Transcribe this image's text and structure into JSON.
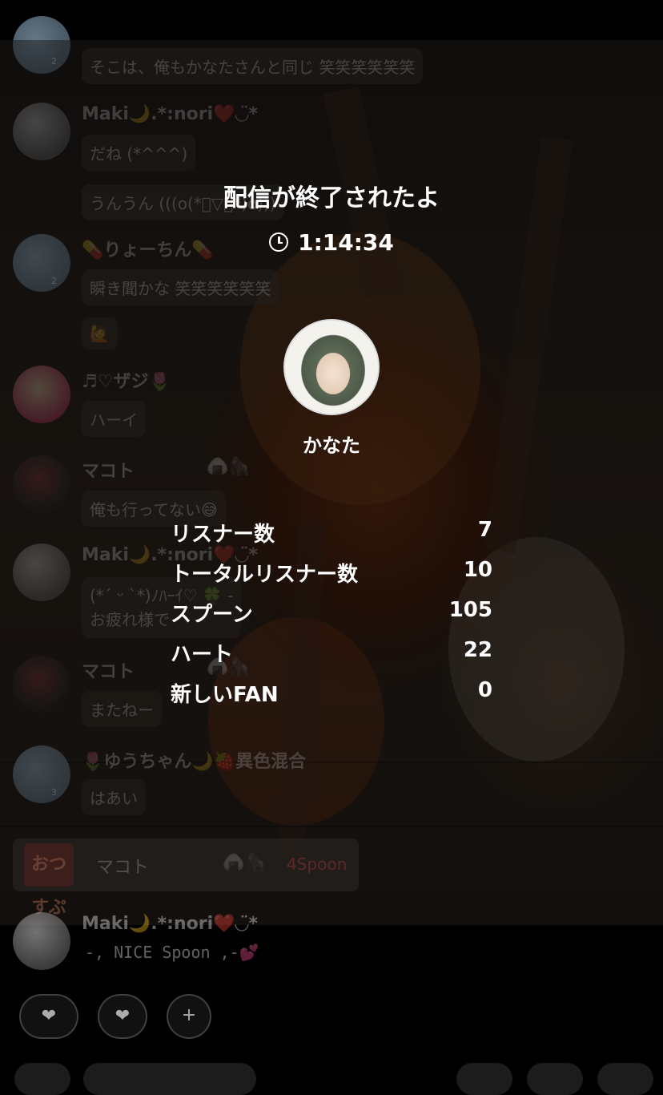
{
  "overlay": {
    "title": "配信が終了されたよ",
    "duration": "1:14:34",
    "host_name": "かなた",
    "stats": [
      {
        "label": "リスナー数",
        "value": "7"
      },
      {
        "label": "トータルリスナー数",
        "value": "10"
      },
      {
        "label": "スプーン",
        "value": "105"
      },
      {
        "label": "ハート",
        "value": "22"
      },
      {
        "label": "新しいFAN",
        "value": "0"
      }
    ]
  },
  "chat": {
    "messages": [
      {
        "user": "",
        "text": "そこは、俺もかなたさんと同じ 笑笑笑笑笑笑",
        "badge": "2"
      },
      {
        "user": "Maki🌙.*:nori❤️◡̈*",
        "text": "だね (*^^^)"
      },
      {
        "user": "",
        "text": "うんうん (((o(*゚▽゚*)o)))"
      },
      {
        "user": "💊りょーちん💊",
        "text": "瞬き聞かな 笑笑笑笑笑笑",
        "badge": "2"
      },
      {
        "user": "",
        "text": "🙋"
      },
      {
        "user": "♬♡ザジ🌷",
        "text": "ハーイ"
      },
      {
        "user": "マコト",
        "user_emoji": "🍙🦍",
        "text": "俺も行ってない😅"
      },
      {
        "user": "Maki🌙.*:nori❤️◡̈*",
        "text": "(*ˊ ᵕ ˋ*)ﾉﾊｰｲ♡ 🍀 -",
        "text2": "お疲れ様で"
      },
      {
        "user": "マコト",
        "user_emoji": "🍙🦍",
        "text": "またねー"
      },
      {
        "user": "🌷ゆうちゃん🌙🍓異色混合",
        "text": "はあい",
        "badge": "3"
      },
      {
        "user": "Maki🌙.*:nori❤️◡̈*",
        "text": "-, NICE Spoon ,-💕"
      }
    ],
    "gift": {
      "logo_text": "おつ すぷ",
      "name": "マコト",
      "emoji": "🍙🦍",
      "amount": "4Spoon"
    }
  },
  "controls": {
    "heart_label": "❤",
    "plus_label": "+"
  }
}
